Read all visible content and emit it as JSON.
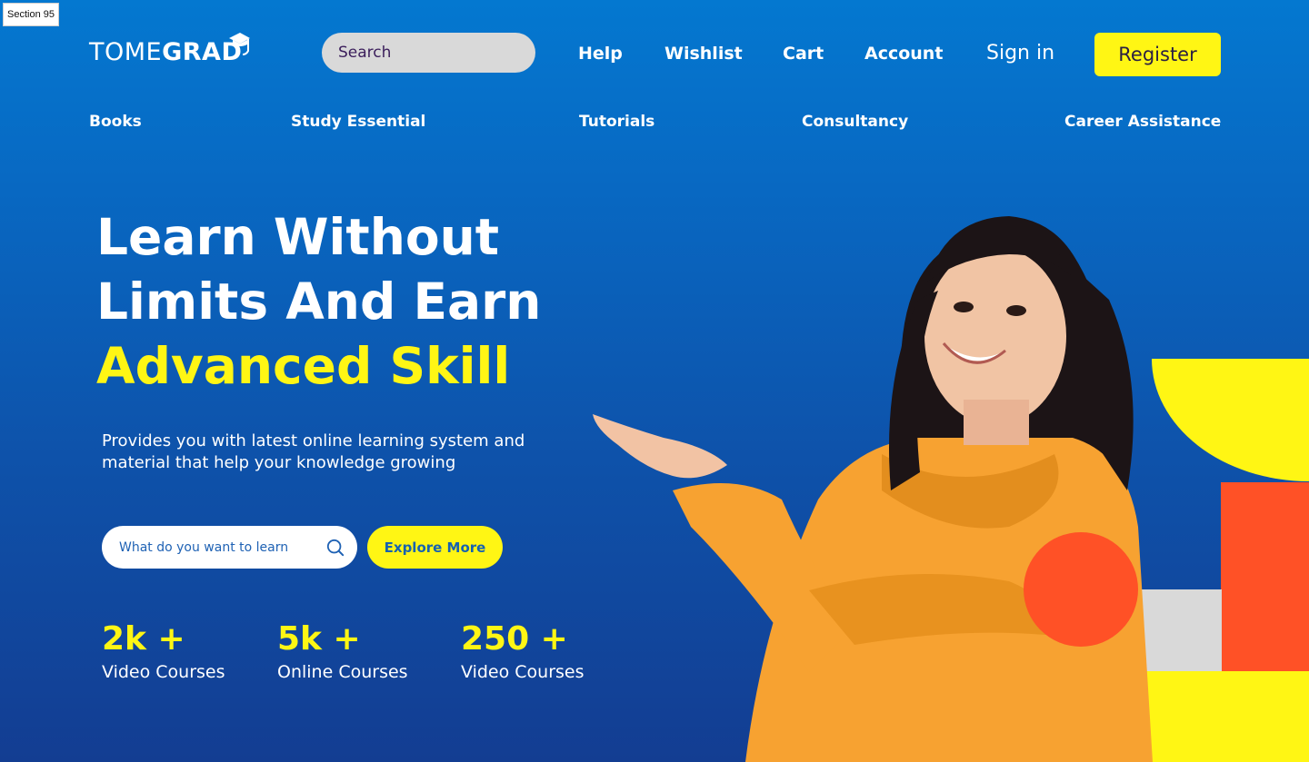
{
  "frame_label": "Section 95",
  "header": {
    "logo_light": "TOME",
    "logo_bold": "GRAD",
    "search_placeholder": "Search",
    "links": [
      "Help",
      "Wishlist",
      "Cart",
      "Account"
    ],
    "signin": "Sign in",
    "register": "Register"
  },
  "categories": [
    "Books",
    "Study Essential",
    "Tutorials",
    "Consultancy",
    "Career Assistance"
  ],
  "hero": {
    "title_line1": "Learn Without",
    "title_line2": "Limits And Earn",
    "title_line3": "Advanced Skill",
    "subtitle": "Provides you with latest online learning system and material that help your knowledge growing",
    "learn_placeholder": "What do you want to learn",
    "explore": "Explore More"
  },
  "stats": [
    {
      "value": "2k +",
      "label": "Video Courses"
    },
    {
      "value": "5k +",
      "label": "Online Courses"
    },
    {
      "value": "250 +",
      "label": "Video Courses"
    }
  ],
  "colors": {
    "accent_yellow": "#fff614",
    "accent_orange": "#ff5126",
    "background_blue": "#0e52aa",
    "hoodie_orange": "#f7a231"
  },
  "icons": [
    "search-icon",
    "graduation-cap-icon"
  ]
}
